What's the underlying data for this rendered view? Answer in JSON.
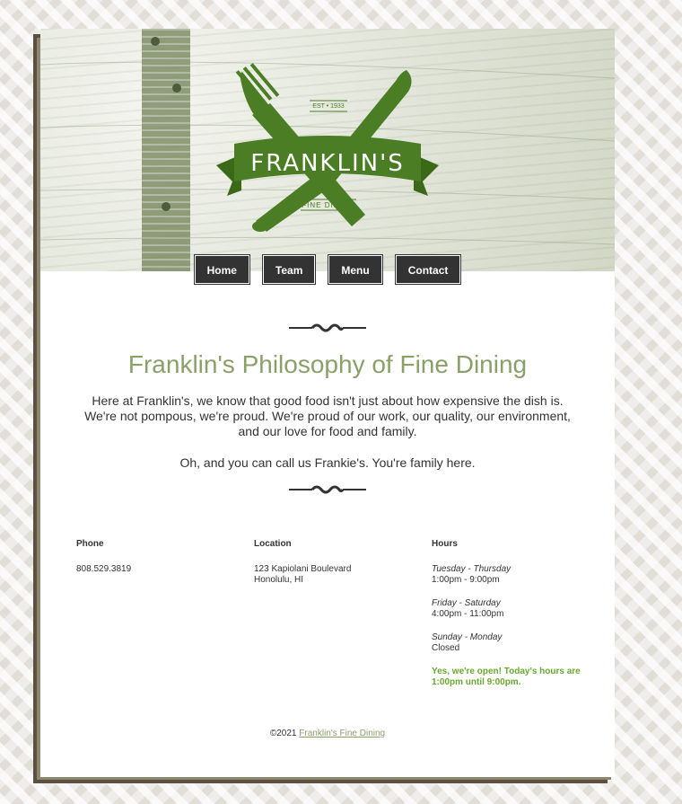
{
  "logo": {
    "name": "FRANKLIN'S",
    "est": "EST • 1933",
    "tagline": "FINE DINING"
  },
  "nav": {
    "items": [
      "Home",
      "Team",
      "Menu",
      "Contact"
    ]
  },
  "main": {
    "title": "Franklin's Philosophy of Fine Dining",
    "intro": "Here at Franklin's, we know that good food isn't just about how expensive the dish is. We're not pompous, we're proud. We're proud of our work, our quality, our environment, and our love for food and family.",
    "intro2": "Oh, and you can call us Frankie's. You're family here."
  },
  "info": {
    "phone": {
      "heading": "Phone",
      "value": "808.529.3819"
    },
    "location": {
      "heading": "Location",
      "line1": "123 Kapiolani Boulevard",
      "line2": "Honolulu, HI"
    },
    "hours": {
      "heading": "Hours",
      "entries": [
        {
          "days": "Tuesday - Thursday",
          "time": "1:00pm - 9:00pm"
        },
        {
          "days": "Friday - Saturday",
          "time": "4:00pm - 11:00pm"
        },
        {
          "days": "Sunday - Monday",
          "time": "Closed"
        }
      ],
      "status_line1": "Yes, we're open! Today's hours are",
      "status_line2": "1:00pm until 9:00pm."
    }
  },
  "footer": {
    "copyright": "©2021",
    "link": "Franklin's Fine Dining"
  },
  "colors": {
    "accent_green": "#8aa069",
    "logo_green": "#4a7d24",
    "open_green": "#6aa82f",
    "nav_bg": "#333333"
  }
}
